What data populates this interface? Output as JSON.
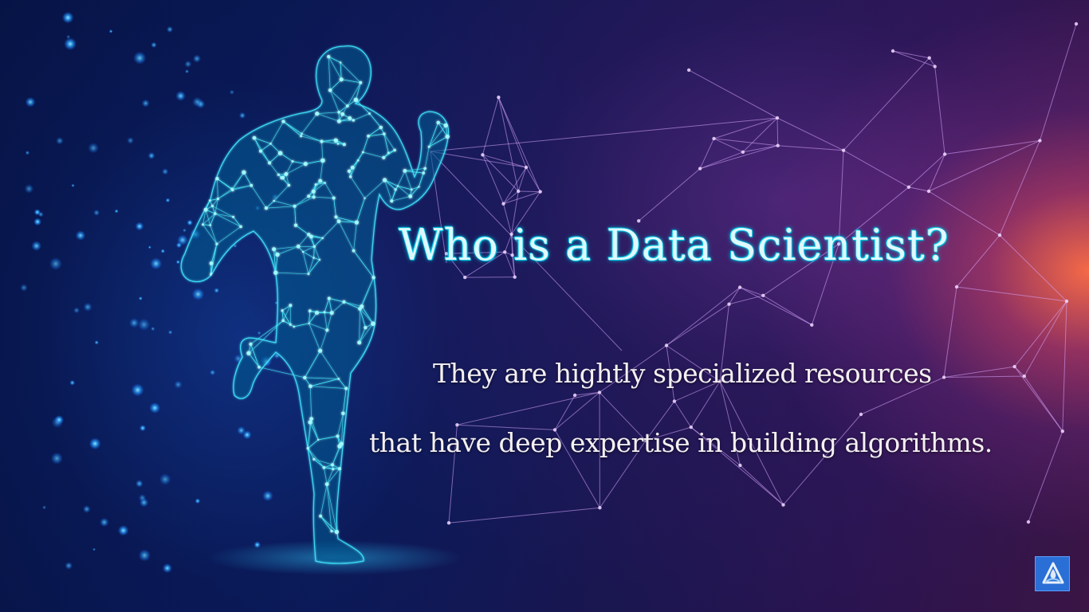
{
  "slide": {
    "title": "Who is a Data Scientist?",
    "body_lines": [
      "They are hightly specialized resources",
      "that have deep expertise in building algorithms."
    ],
    "logo_icon": "triangle-swirl-logo-icon"
  },
  "colors": {
    "title_glow": "#00c8e8",
    "title_text": "#dff8ff",
    "body_text": "#f4f0f2",
    "figure_mesh": "#3fe6ff",
    "network_lines": "#c98fff",
    "flare": "#ff6e46",
    "badge": "#2a6fd6"
  }
}
